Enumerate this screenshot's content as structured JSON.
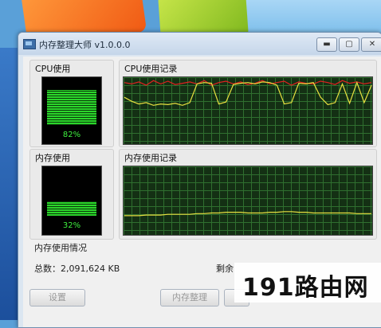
{
  "window": {
    "title": "内存整理大师 v1.0.0.0",
    "min_glyph": "▬",
    "max_glyph": "▢",
    "close_glyph": "✕"
  },
  "cpu": {
    "label": "CPU使用",
    "percent_text": "82%",
    "percent": 82,
    "history_label": "CPU使用记录"
  },
  "memory": {
    "label": "内存使用",
    "percent_text": "32%",
    "percent": 32,
    "history_label": "内存使用记录"
  },
  "memory_info": {
    "section_label": "内存使用情况",
    "total_text": "总数：2,091,624 KB",
    "remaining_label": "剩余"
  },
  "buttons": {
    "settings": "设置",
    "organize": "内存整理"
  },
  "watermark": {
    "text": "191路由网"
  },
  "colors": {
    "gauge_green": "#2bd62b",
    "cpu_line_red": "#e02020",
    "cpu_line_yellow": "#e8e040",
    "mem_line_yellow": "#e8e040"
  },
  "chart_data": [
    {
      "type": "line",
      "series": [
        {
          "values": [
            92,
            90,
            93,
            88,
            95,
            90,
            94,
            89,
            91,
            93,
            90,
            95,
            88,
            92,
            94,
            90,
            93,
            89,
            91,
            95,
            90,
            92,
            94,
            88,
            93,
            91,
            90,
            94,
            92,
            89,
            95,
            91,
            93,
            90,
            92
          ]
        },
        {
          "values": [
            70,
            64,
            60,
            62,
            58,
            60,
            59,
            61,
            58,
            62,
            90,
            92,
            91,
            60,
            63,
            89,
            91,
            92,
            90,
            93,
            92,
            88,
            60,
            62,
            91,
            90,
            92,
            70,
            59,
            62,
            90,
            61,
            92,
            62,
            88
          ]
        }
      ],
      "ylim": [
        0,
        100
      ],
      "grid": true
    },
    {
      "type": "line",
      "series": [
        {
          "values": [
            28,
            28,
            28,
            29,
            29,
            29,
            30,
            30,
            30,
            30,
            31,
            31,
            32,
            32,
            33,
            33,
            33,
            32,
            32,
            32,
            33,
            33,
            34,
            34,
            33,
            33,
            32,
            32,
            32,
            32,
            32,
            32,
            31,
            31,
            31
          ]
        }
      ],
      "ylim": [
        0,
        100
      ],
      "grid": true
    }
  ]
}
